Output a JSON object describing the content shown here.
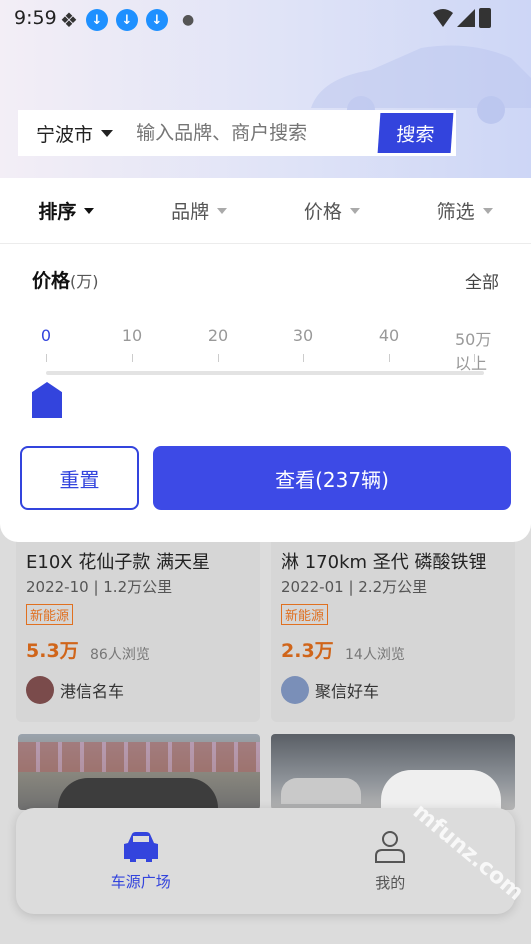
{
  "status_bar": {
    "time": "9:59"
  },
  "search": {
    "city": "宁波市",
    "placeholder": "输入品牌、商户搜索",
    "button_label": "搜索"
  },
  "filter_tabs": [
    {
      "label": "排序",
      "active": true
    },
    {
      "label": "品牌",
      "active": false
    },
    {
      "label": "价格",
      "active": false
    },
    {
      "label": "筛选",
      "active": false
    }
  ],
  "price_filter": {
    "title": "价格",
    "unit": "(万)",
    "all_label": "全部",
    "ticks": [
      "0",
      "10",
      "20",
      "30",
      "40",
      "50万以上"
    ],
    "selected_min": "0",
    "reset_label": "重置",
    "view_label": "查看(237辆)"
  },
  "listings": [
    {
      "title": "E10X 花仙子款 满天星",
      "meta": "2022-10 | 1.2万公里",
      "tag": "新能源",
      "price": "5.3万",
      "views": "86人浏览",
      "dealer": "港信名车"
    },
    {
      "title": "淋 170km 圣代 磷酸铁锂",
      "meta": "2022-01 | 2.2万公里",
      "tag": "新能源",
      "price": "2.3万",
      "views": "14人浏览",
      "dealer": "聚信好车"
    }
  ],
  "bottom_nav": [
    {
      "label": "车源广场",
      "icon": "car-icon",
      "active": true
    },
    {
      "label": "我的",
      "icon": "user-icon",
      "active": false
    }
  ],
  "watermark": "mfunz.com"
}
